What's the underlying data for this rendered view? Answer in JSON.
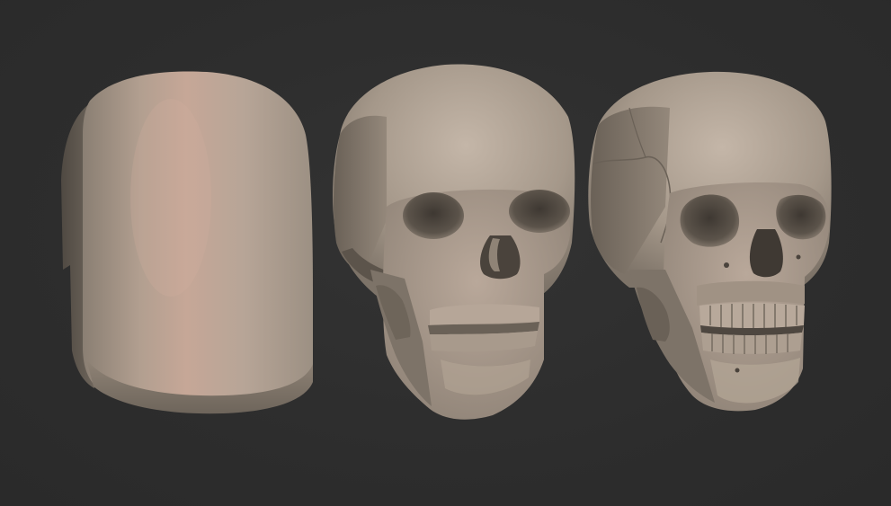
{
  "scene": {
    "background": "#2d2d2d",
    "clay_color": "#a89a8c",
    "clay_highlight": "#c9a99a",
    "clay_shadow": "#5e564d",
    "models": [
      {
        "name": "blockout-capsule",
        "stage": "blockout"
      },
      {
        "name": "planar-skull",
        "stage": "planes"
      },
      {
        "name": "detailed-skull",
        "stage": "detail"
      }
    ]
  }
}
